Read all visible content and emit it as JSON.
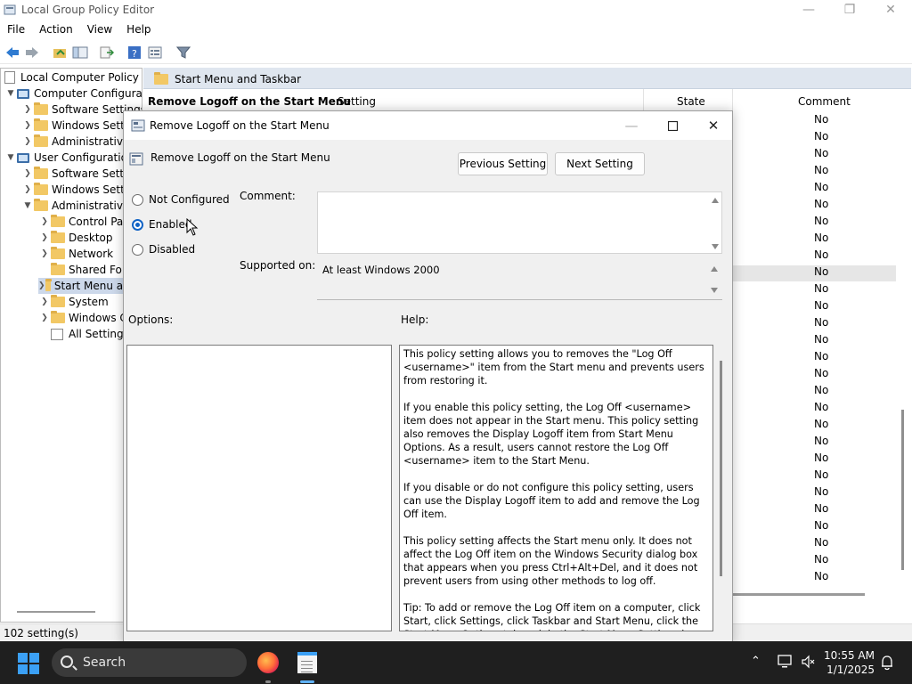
{
  "window": {
    "title": "Local Group Policy Editor"
  },
  "menu": [
    "File",
    "Action",
    "View",
    "Help"
  ],
  "tree": {
    "root": "Local Computer Policy",
    "items": [
      "Computer Configuration",
      "Software Settings",
      "Windows Settings",
      "Administrative Templates",
      "User Configuration",
      "Software Settings",
      "Windows Settings",
      "Administrative Templates",
      "Control Panel",
      "Desktop",
      "Network",
      "Shared Folders",
      "Start Menu and Taskbar",
      "System",
      "Windows Components",
      "All Settings"
    ]
  },
  "right_pane": {
    "header": "Start Menu and Taskbar",
    "policy_title": "Remove Logoff on the Start Menu",
    "columns": {
      "setting": "Setting",
      "state": "State",
      "comment": "Comment"
    },
    "comments": [
      "No",
      "No",
      "No",
      "No",
      "No",
      "No",
      "No",
      "No",
      "No",
      "No",
      "No",
      "No",
      "No",
      "No",
      "No",
      "No",
      "No",
      "No",
      "No",
      "No",
      "No",
      "No",
      "No",
      "No",
      "No",
      "No",
      "No",
      "No"
    ]
  },
  "status": {
    "text": "102 setting(s)"
  },
  "dialog": {
    "title": "Remove Logoff on the Start Menu",
    "policy_name": "Remove Logoff on the Start Menu",
    "prev_button": "Previous Setting",
    "next_button": "Next Setting",
    "radio_not_configured": "Not Configured",
    "radio_enabled": "Enabled",
    "radio_disabled": "Disabled",
    "selected": "Enabled",
    "comment_label": "Comment:",
    "supported_label": "Supported on:",
    "supported_value": "At least Windows 2000",
    "options_label": "Options:",
    "help_label": "Help:",
    "help_paragraphs": [
      "This policy setting allows you to removes the \"Log Off <username>\" item from the Start menu and prevents users from restoring it.",
      "If you enable this policy setting, the Log Off <username> item does not appear in the Start menu. This policy setting also removes the Display Logoff item from Start Menu Options. As a result, users cannot restore the Log Off <username> item to the Start Menu.",
      "If you disable or do not configure this policy setting, users can use the Display Logoff item to add and remove the Log Off item.",
      "This policy setting affects the Start menu only. It does not affect the Log Off item on the Windows Security dialog box that appears when you press Ctrl+Alt+Del, and it does not prevent users from using other methods to log off.",
      "Tip: To add or remove the Log Off item on a computer, click Start, click Settings, click Taskbar and Start Menu, click the Start Menu Options tab and, in the Start Menu Settings box, click Display Logoff."
    ]
  },
  "taskbar": {
    "search_label": "Search",
    "time": "10:55 AM",
    "date": "1/1/2025"
  },
  "colors": {
    "accent": "#0f62c5",
    "folder": "#f2c865",
    "taskbar": "#1f1f1f"
  }
}
